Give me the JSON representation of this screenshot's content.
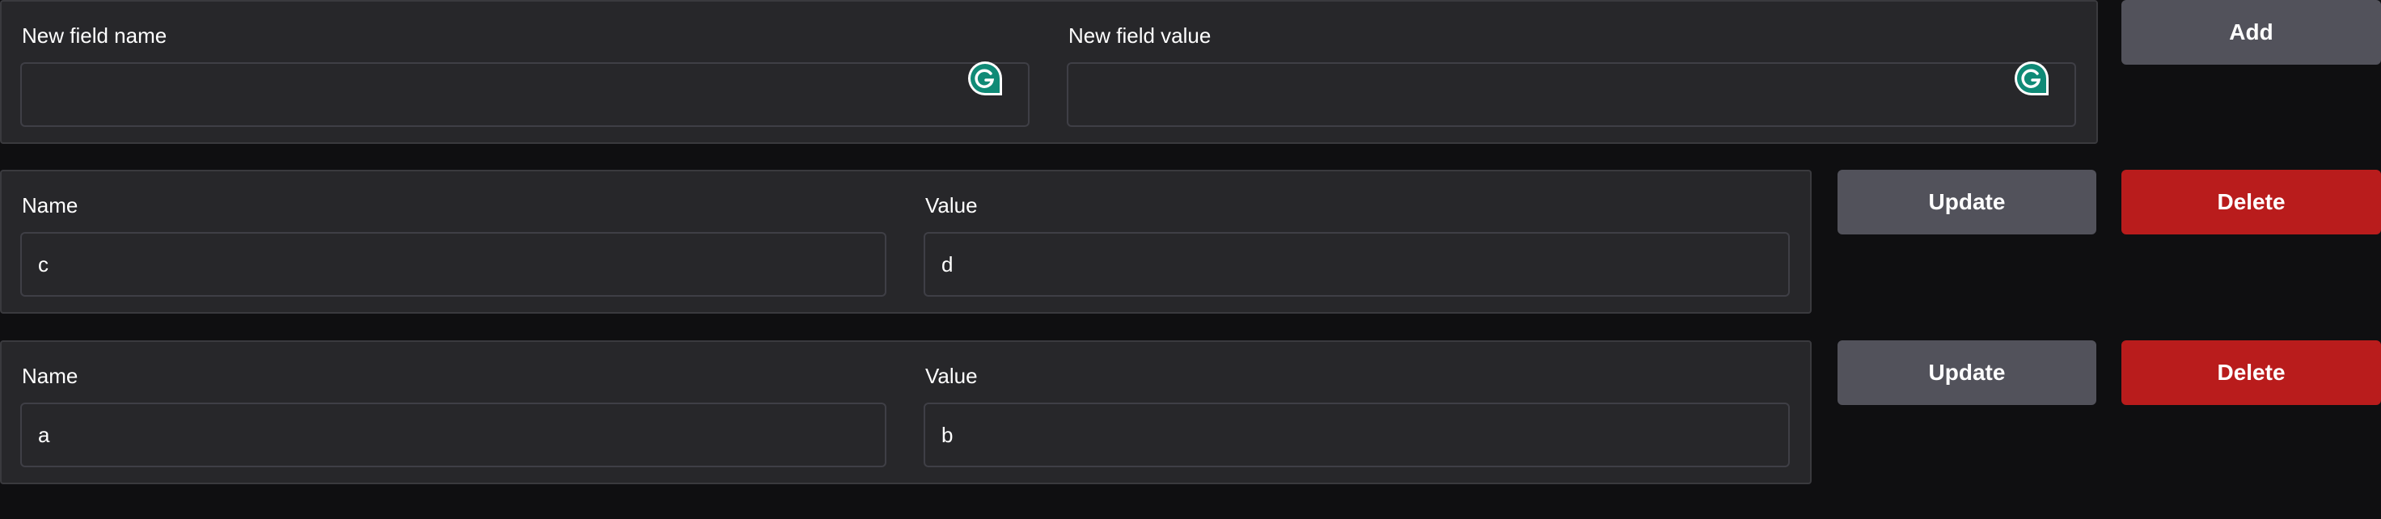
{
  "new_field": {
    "name_label": "New field name",
    "value_label": "New field value",
    "name_value": "",
    "value_value": "",
    "add_label": "Add"
  },
  "rows": [
    {
      "name_label": "Name",
      "value_label": "Value",
      "name_value": "c",
      "value_value": "d",
      "update_label": "Update",
      "delete_label": "Delete"
    },
    {
      "name_label": "Name",
      "value_label": "Value",
      "name_value": "a",
      "value_value": "b",
      "update_label": "Update",
      "delete_label": "Delete"
    }
  ],
  "icons": {
    "input_assistant": "grammarly-icon"
  },
  "colors": {
    "background": "#0f0f11",
    "panel": "#27272a",
    "neutral_button": "#52525b",
    "danger_button": "#b91c1c",
    "grammarly": "#0f8a76"
  }
}
